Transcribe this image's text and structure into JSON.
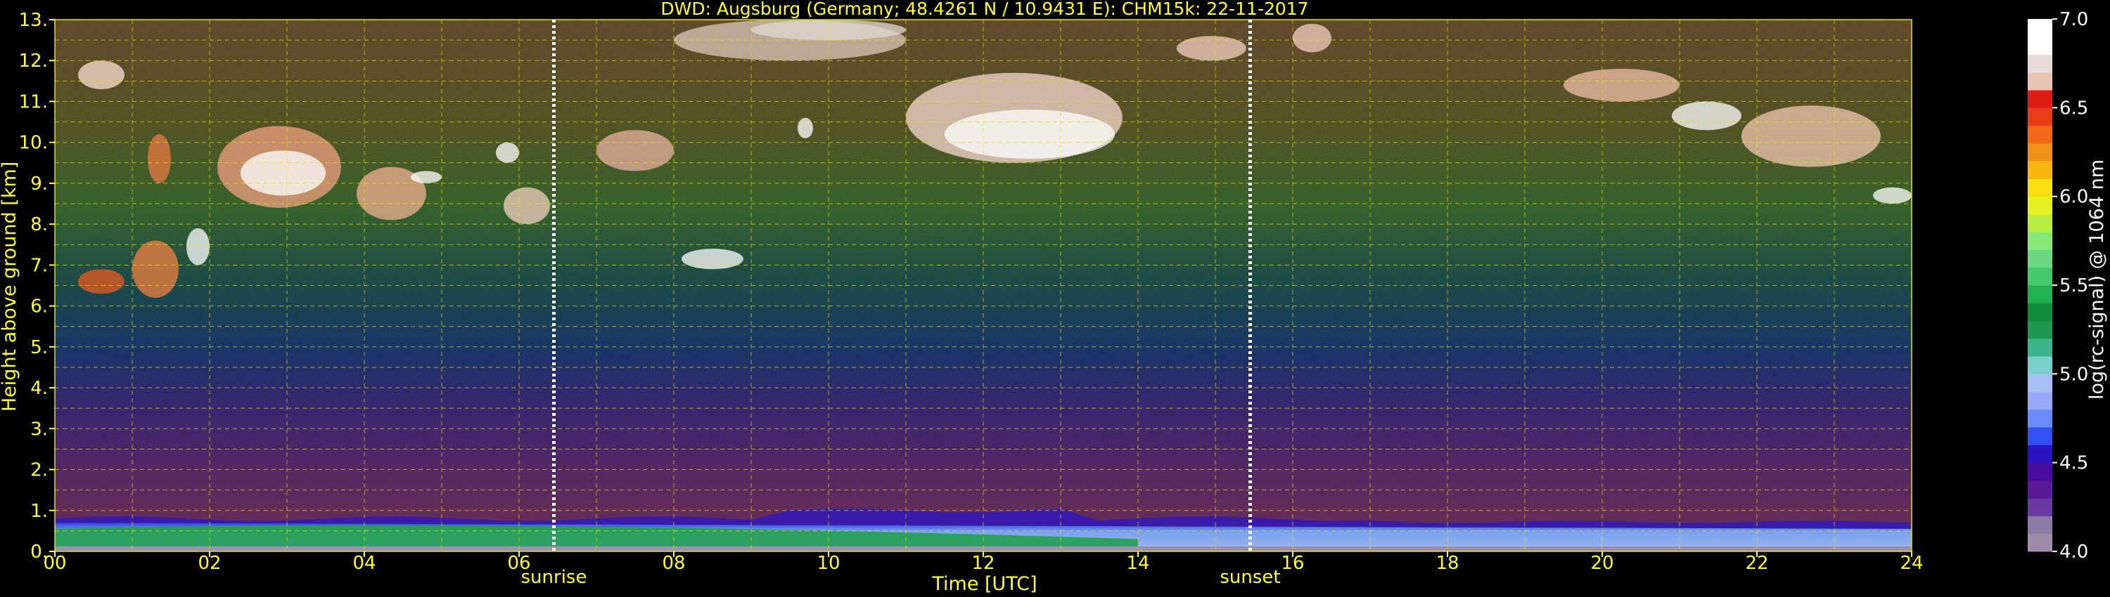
{
  "chart_data": {
    "type": "heatmap",
    "title": "DWD: Augsburg (Germany; 48.4261 N / 10.9431 E):    CHM15k: 22-11-2017",
    "xlabel": "Time [UTC]",
    "ylabel": "Height above ground [km]",
    "xlim": [
      0,
      24
    ],
    "ylim": [
      0,
      13
    ],
    "x_ticks": [
      0,
      2,
      4,
      6,
      8,
      10,
      12,
      14,
      16,
      18,
      20,
      22,
      24
    ],
    "x_tick_labels": [
      "00",
      "02",
      "04",
      "06",
      "08",
      "10",
      "12",
      "14",
      "16",
      "18",
      "20",
      "22",
      "24"
    ],
    "y_ticks": [
      0,
      1,
      2,
      3,
      4,
      5,
      6,
      7,
      8,
      9,
      10,
      11,
      12,
      13
    ],
    "y_tick_labels": [
      "0.",
      "1.",
      "2.",
      "3.",
      "4.",
      "5.",
      "6.",
      "7.",
      "8.",
      "9.",
      "10.",
      "11.",
      "12.",
      "13."
    ],
    "grid": true,
    "events": [
      {
        "label": "sunrise",
        "time": 6.45
      },
      {
        "label": "sunset",
        "time": 15.45
      }
    ],
    "colorbar": {
      "label": "log(rc-signal) @ 1064 nm",
      "range": [
        4.0,
        7.0
      ],
      "ticks": [
        4.0,
        4.5,
        5.0,
        5.5,
        6.0,
        6.5,
        7.0
      ],
      "tick_labels": [
        "4.0",
        "4.5",
        "5.0",
        "5.5",
        "6.0",
        "6.5",
        "7.0"
      ],
      "colors": [
        "#a08ca8",
        "#8a7aa4",
        "#6a3aa0",
        "#5a1a98",
        "#4a0ca0",
        "#2a14c0",
        "#3050f0",
        "#6a8af8",
        "#9aa8f8",
        "#a8c0f4",
        "#7ad0c8",
        "#3cb48c",
        "#1e9650",
        "#108c3c",
        "#22b050",
        "#44c86c",
        "#6ad884",
        "#88e878",
        "#b8ec40",
        "#e8f020",
        "#f8e010",
        "#f8b810",
        "#f09018",
        "#f06818",
        "#e83c18",
        "#e01c18",
        "#e8c4b4",
        "#e8dcd8",
        "#ffffff",
        "#ffffff"
      ]
    }
  }
}
